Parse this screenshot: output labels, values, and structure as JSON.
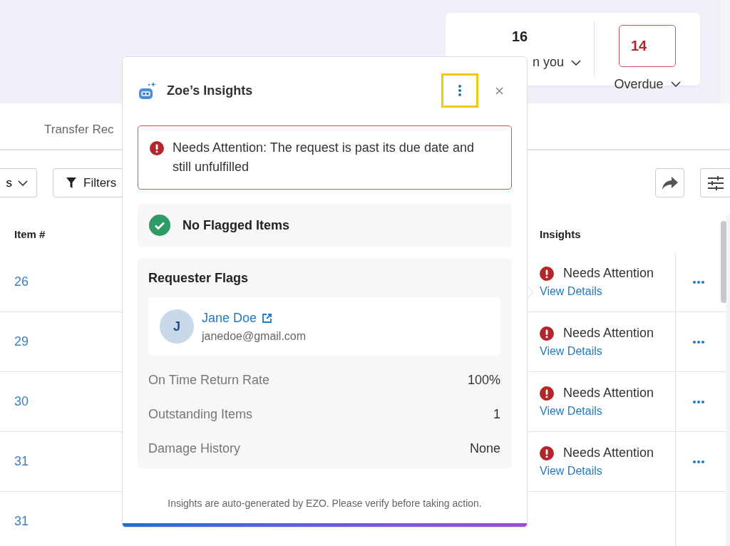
{
  "summary": {
    "stats": [
      {
        "value": "16",
        "label": "n you",
        "kind": "normal"
      },
      {
        "value": "14",
        "label": "Overdue",
        "kind": "alert"
      }
    ]
  },
  "tabs": [
    {
      "label": "Transfer Rec",
      "selected": false
    }
  ],
  "toolbar": {
    "dropdown": "s",
    "filters": "Filters"
  },
  "table": {
    "columns": [
      "Item #",
      "Insights"
    ],
    "rows": [
      {
        "item": "26",
        "insight": "Needs Attention",
        "link": "View Details"
      },
      {
        "item": "29",
        "insight": "Needs Attention",
        "link": "View Details"
      },
      {
        "item": "30",
        "insight": "Needs Attention",
        "link": "View Details"
      },
      {
        "item": "31",
        "insight": "Needs Attention",
        "link": "View Details"
      },
      {
        "item": "31"
      }
    ]
  },
  "popup": {
    "title": "Zoe’s Insights",
    "menu_highlighted": true,
    "alert": "Needs Attention: The request is past its due date and still unfulfilled",
    "flag_status": "No Flagged Items",
    "requester": {
      "heading": "Requester Flags",
      "initial": "J",
      "name": "Jane Doe",
      "email": "janedoe@gmail.com",
      "stats": [
        {
          "label": "On Time Return Rate",
          "value": "100%"
        },
        {
          "label": "Outstanding Items",
          "value": "1"
        },
        {
          "label": "Damage History",
          "value": "None"
        }
      ]
    },
    "footer": "Insights are auto-generated by EZO. Please verify before taking action."
  }
}
